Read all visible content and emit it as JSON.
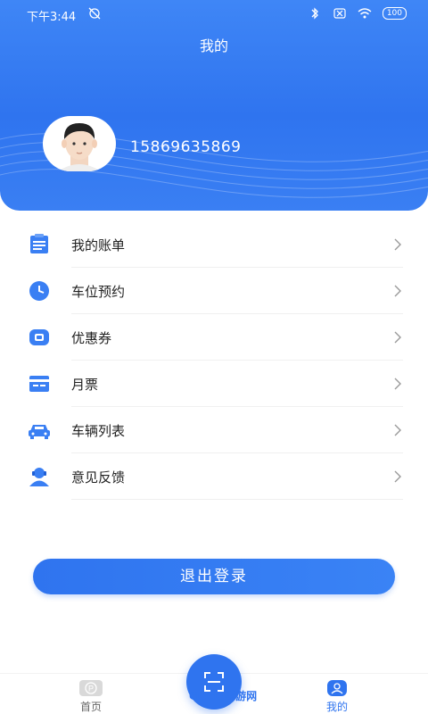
{
  "status_bar": {
    "time": "下午3:44",
    "battery": "100"
  },
  "header": {
    "title": "我的",
    "phone": "15869635869"
  },
  "menu": {
    "items": [
      {
        "label": "我的账单",
        "icon": "bill-icon"
      },
      {
        "label": "车位预约",
        "icon": "clock-icon"
      },
      {
        "label": "优惠券",
        "icon": "coupon-icon"
      },
      {
        "label": "月票",
        "icon": "ticket-icon"
      },
      {
        "label": "车辆列表",
        "icon": "car-icon"
      },
      {
        "label": "意见反馈",
        "icon": "feedback-icon"
      }
    ]
  },
  "logout_label": "退出登录",
  "tabbar": {
    "home_label": "首页",
    "mine_label": "我的"
  },
  "watermark": "GOGO手游网",
  "colors": {
    "primary": "#2f74ef",
    "header": "#3f86f6"
  }
}
